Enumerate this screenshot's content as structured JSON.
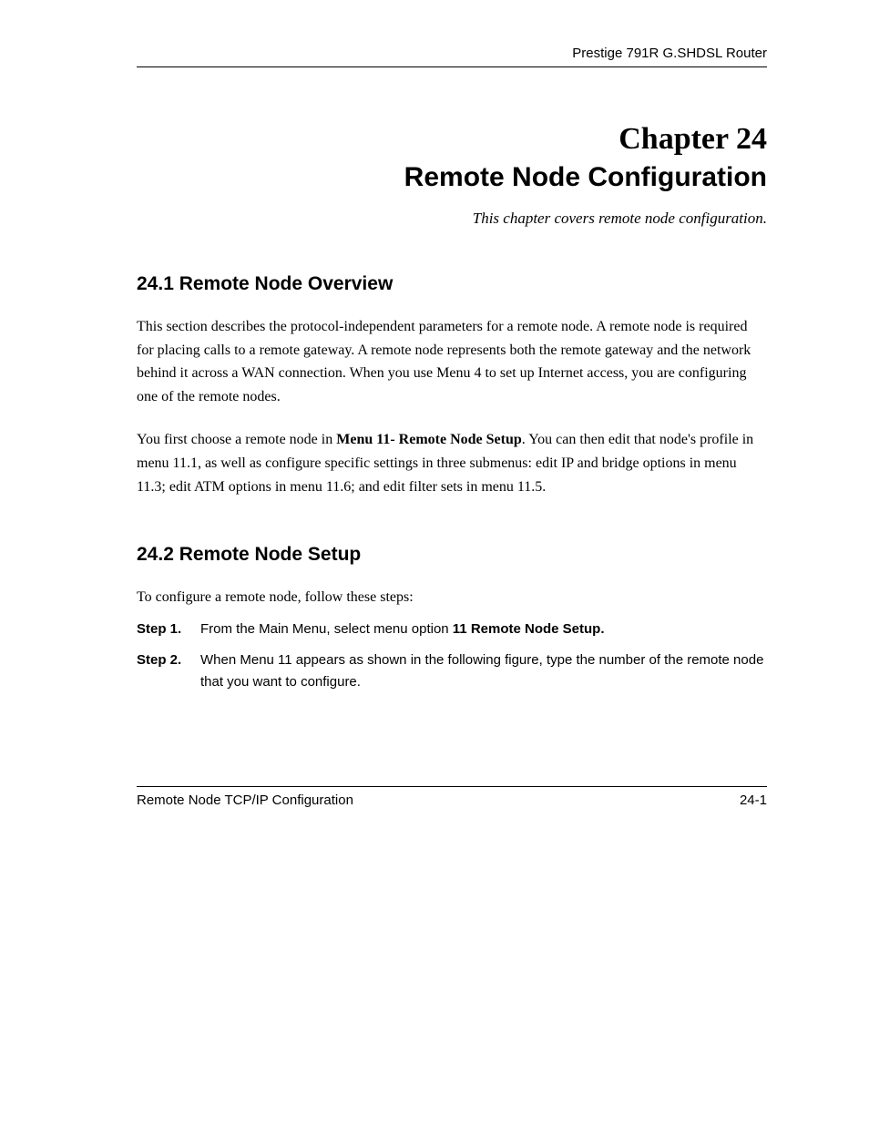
{
  "header": {
    "running_title": "Prestige 791R G.SHDSL Router"
  },
  "chapter": {
    "number_label": "Chapter 24",
    "title": "Remote Node Configuration",
    "subtitle": "This chapter covers remote node configuration."
  },
  "sections": {
    "s1": {
      "heading": "24.1  Remote Node Overview",
      "p1": "This section describes the protocol-independent parameters for a remote node. A remote node is required for placing calls to a remote gateway. A remote node represents both the remote gateway and the network behind it across a WAN connection. When you use Menu 4 to set up Internet access, you are configuring one of the remote nodes.",
      "p2_pre": "You first choose a remote node in ",
      "p2_bold": "Menu 11- Remote Node Setup",
      "p2_post": ". You can then edit that node's profile in menu 11.1, as well as configure specific settings in three submenus: edit IP and bridge options in menu 11.3; edit ATM options in menu 11.6; and edit filter sets in menu 11.5."
    },
    "s2": {
      "heading": "24.2  Remote Node Setup",
      "intro": "To configure a remote node, follow these steps:",
      "steps": [
        {
          "label": "Step 1.",
          "pre": "From the Main Menu, select menu option ",
          "bold": "11 Remote Node Setup.",
          "post": ""
        },
        {
          "label": "Step 2.",
          "pre": "When Menu 11 appears as shown in the following figure, type the number of the remote node that you want to configure.",
          "bold": "",
          "post": ""
        }
      ]
    }
  },
  "footer": {
    "left": "Remote Node TCP/IP Configuration",
    "right": "24-1"
  }
}
